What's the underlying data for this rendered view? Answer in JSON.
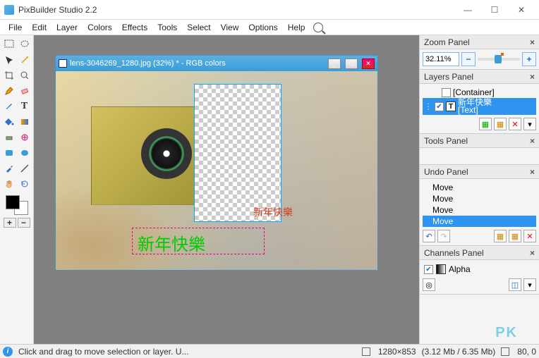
{
  "window": {
    "title": "PixBuilder Studio 2.2"
  },
  "menu": [
    "File",
    "Edit",
    "Layer",
    "Colors",
    "Effects",
    "Tools",
    "Select",
    "View",
    "Options",
    "Help"
  ],
  "document": {
    "title": "lens-3046269_1280.jpg (32%) * - RGB colors",
    "green_text": "新年快樂",
    "red_text": "新年快樂"
  },
  "zoom": {
    "panel_title": "Zoom Panel",
    "value": "32.11%"
  },
  "layers": {
    "panel_title": "Layers Panel",
    "container_label": "[Container]",
    "text_name": "新年快樂",
    "text_label": "[Text]"
  },
  "tools_panel": {
    "title": "Tools Panel"
  },
  "undo": {
    "panel_title": "Undo Panel",
    "items": [
      "Move",
      "Move",
      "Move",
      "Move"
    ]
  },
  "channels": {
    "panel_title": "Channels Panel",
    "alpha": "Alpha"
  },
  "status": {
    "hint": "Click and drag to move selection or layer. U...",
    "dims": "1280×853",
    "mem": "(3.12 Mb / 6.35 Mb)",
    "pos": "80, 0"
  },
  "watermark": "PK"
}
